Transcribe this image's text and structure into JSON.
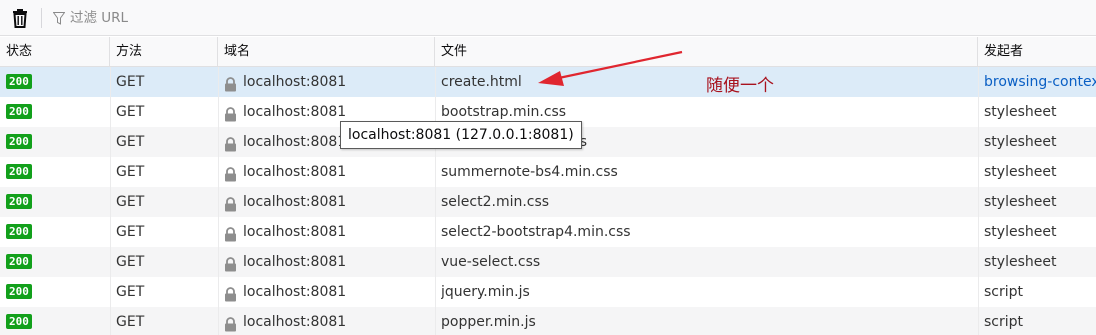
{
  "toolbar": {
    "clear_icon": "trash-icon",
    "filter_icon": "filter-icon",
    "filter_placeholder": "过滤 URL"
  },
  "columns": {
    "status": "状态",
    "method": "方法",
    "domain": "域名",
    "file": "文件",
    "initiator": "发起者"
  },
  "rows": [
    {
      "status": "200",
      "method": "GET",
      "domain": "localhost:8081",
      "file": "create.html",
      "initiator": "browsing-contex"
    },
    {
      "status": "200",
      "method": "GET",
      "domain": "localhost:8081",
      "file": "bootstrap.min.css",
      "initiator": "stylesheet"
    },
    {
      "status": "200",
      "method": "GET",
      "domain": "localhost:8081",
      "file": "summernote-bs4.css",
      "initiator": "stylesheet"
    },
    {
      "status": "200",
      "method": "GET",
      "domain": "localhost:8081",
      "file": "summernote-bs4.min.css",
      "initiator": "stylesheet"
    },
    {
      "status": "200",
      "method": "GET",
      "domain": "localhost:8081",
      "file": "select2.min.css",
      "initiator": "stylesheet"
    },
    {
      "status": "200",
      "method": "GET",
      "domain": "localhost:8081",
      "file": "select2-bootstrap4.min.css",
      "initiator": "stylesheet"
    },
    {
      "status": "200",
      "method": "GET",
      "domain": "localhost:8081",
      "file": "vue-select.css",
      "initiator": "stylesheet"
    },
    {
      "status": "200",
      "method": "GET",
      "domain": "localhost:8081",
      "file": "jquery.min.js",
      "initiator": "script"
    },
    {
      "status": "200",
      "method": "GET",
      "domain": "localhost:8081",
      "file": "popper.min.js",
      "initiator": "script"
    }
  ],
  "tooltip": "localhost:8081 (127.0.0.1:8081)",
  "annotation": {
    "text": "随便一个",
    "color": "#e0262f"
  },
  "colors": {
    "status_ok": "#12a01b",
    "selected_row": "#dcebf8",
    "initiator_link": "#0a5fc4"
  }
}
